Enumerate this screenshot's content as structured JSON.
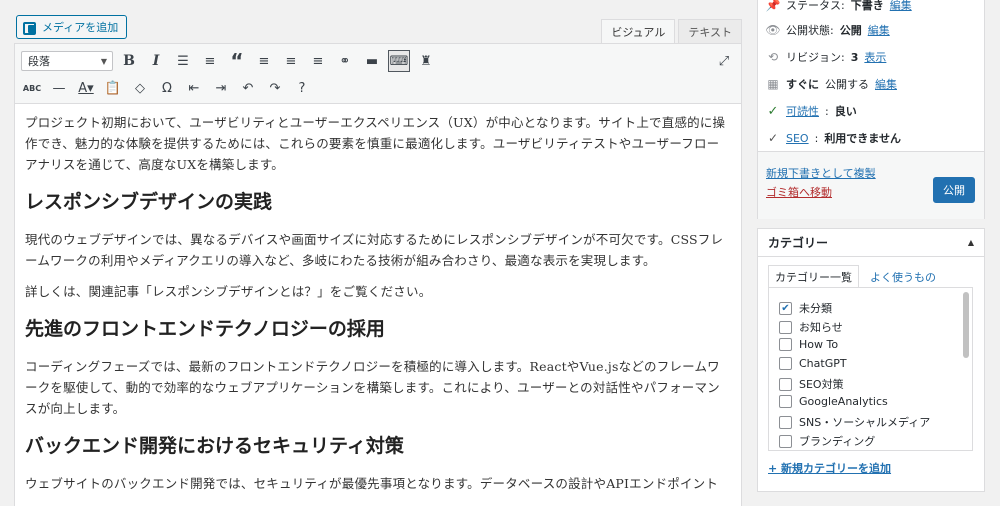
{
  "media_button": "メディアを追加",
  "editor_tabs": [
    "ビジュアル",
    "テキスト"
  ],
  "toolbar": {
    "format_value": "段落",
    "row1_icons": [
      "bold-icon",
      "italic-icon",
      "bullet-list-icon",
      "numbered-list-icon",
      "blockquote-icon",
      "align-left-icon",
      "align-center-icon",
      "align-right-icon",
      "link-icon",
      "read-more-icon",
      "toolbar-toggle-icon",
      "spy-icon"
    ],
    "row2_icons": [
      "strikethrough-icon",
      "horizontal-line-icon",
      "text-color-icon",
      "paste-text-icon",
      "clear-formatting-icon",
      "special-character-icon",
      "outdent-icon",
      "indent-icon",
      "undo-icon",
      "redo-icon",
      "help-icon"
    ],
    "fullscreen_icon": "fullscreen-icon"
  },
  "content": {
    "p1": "プロジェクト初期において、ユーザビリティとユーザーエクスペリエンス（UX）が中心となります。サイト上で直感的に操作でき、魅力的な体験を提供するためには、これらの要素を慎重に最適化します。ユーザビリティテストやユーザーフローアナリスを通じて、高度なUXを構築します。",
    "h1": "レスポンシブデザインの実践",
    "p2": "現代のウェブデザインでは、異なるデバイスや画面サイズに対応するためにレスポンシブデザインが不可欠です。CSSフレームワークの利用やメディアクエリの導入など、多岐にわたる技術が組み合わさり、最適な表示を実現します。",
    "p3": "詳しくは、関連記事「レスポンシブデザインとは？」をご覧ください。",
    "h2": "先進のフロントエンドテクノロジーの採用",
    "p4": "コーディングフェーズでは、最新のフロントエンドテクノロジーを積極的に導入します。ReactやVue.jsなどのフレームワークを駆使して、動的で効率的なウェブアプリケーションを構築します。これにより、ユーザーとの対話性やパフォーマンスが向上します。",
    "h3": "バックエンド開発におけるセキュリティ対策",
    "p5": "ウェブサイトのバックエンド開発では、セキュリティが最優先事項となります。データベースの設計やAPIエンドポイント"
  },
  "publish": {
    "status_label": "ステータス:",
    "status_value": "下書き",
    "status_edit": "編集",
    "visibility_label": "公開状態:",
    "visibility_value": "公開",
    "visibility_edit": "編集",
    "revision_label": "リビジョン:",
    "revision_value": "3",
    "revision_link": "表示",
    "schedule_value": "すぐに",
    "schedule_label": "公開する",
    "schedule_edit": "編集",
    "readability_label": "可読性",
    "readability_value": "良い",
    "seo_label": "SEO",
    "seo_value": "利用できません",
    "copy_draft": "新規下書きとして複製",
    "trash": "ゴミ箱へ移動",
    "publish_button": "公開"
  },
  "categories": {
    "title": "カテゴリー",
    "tab_all": "カテゴリー一覧",
    "tab_popular": "よく使うもの",
    "items": [
      {
        "label": "未分類",
        "checked": true
      },
      {
        "label": "お知らせ",
        "checked": false
      },
      {
        "label": "How To",
        "checked": false
      },
      {
        "label": "ChatGPT",
        "checked": false
      },
      {
        "label": "SEO対策",
        "checked": false
      },
      {
        "label": "GoogleAnalytics",
        "checked": false
      },
      {
        "label": "SNS・ソーシャルメディア",
        "checked": false
      },
      {
        "label": "ブランディング",
        "checked": false
      }
    ],
    "add_new": "+ 新規カテゴリーを追加"
  },
  "colors": {
    "accent": "#2271b1",
    "danger": "#b32d2e",
    "good": "#2e7d32"
  }
}
